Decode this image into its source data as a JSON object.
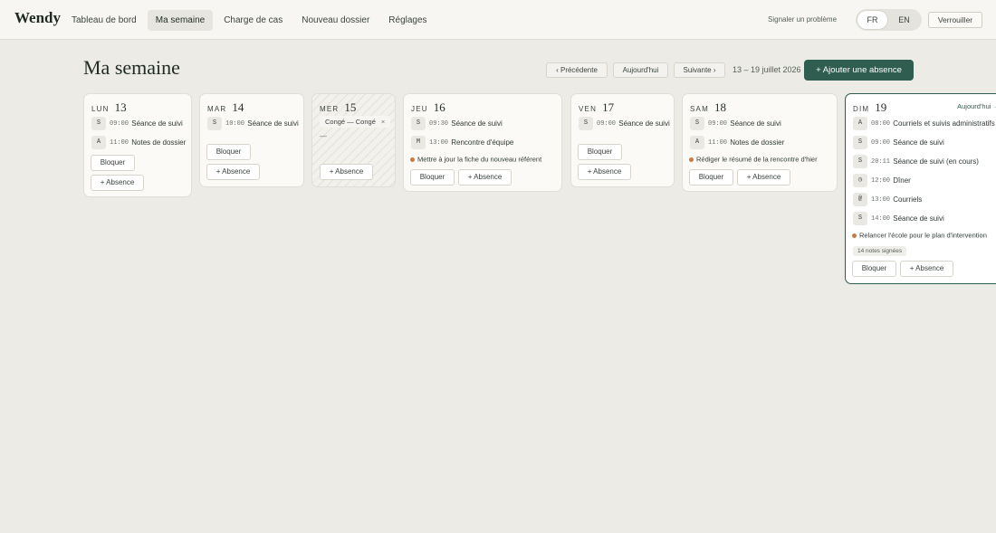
{
  "app": {
    "brand": "Wendy"
  },
  "nav": [
    {
      "label": "Tableau de bord",
      "active": false
    },
    {
      "label": "Ma semaine",
      "active": true
    },
    {
      "label": "Charge de cas",
      "active": false
    },
    {
      "label": "Nouveau dossier",
      "active": false
    },
    {
      "label": "Réglages",
      "active": false
    }
  ],
  "header_right": {
    "report": "Signaler un problème",
    "lang_fr": "FR",
    "lang_en": "EN",
    "lock": "Verrouiller"
  },
  "page": {
    "title": "Ma semaine",
    "prev": "‹ Précédente",
    "today": "Aujourd'hui",
    "next": "Suivante ›",
    "range": "13 – 19 juillet 2026",
    "add_absence": "+ Ajouter une absence"
  },
  "colors": {
    "accent": "#2f5d50",
    "todo_dot": "#c97a45",
    "background": "#ecebe6"
  },
  "icons": {
    "todo": "dot-icon",
    "dinner": "clock-icon",
    "email": "at-icon"
  },
  "days": [
    {
      "dow": "LUN",
      "num": "13",
      "events": [
        {
          "badge": "S",
          "time": "09:00",
          "title": "Séance de suivi"
        },
        {
          "badge": "A",
          "time": "11:00",
          "title": "Notes de dossier"
        }
      ],
      "block": "Bloquer",
      "absence": "+ Absence"
    },
    {
      "dow": "MAR",
      "num": "14",
      "events": [
        {
          "badge": "S",
          "time": "10:00",
          "title": "Séance de suivi"
        }
      ],
      "block": "Bloquer",
      "absence": "+ Absence"
    },
    {
      "dow": "MER",
      "num": "15",
      "leave": "Congé — Congé",
      "leave_close": "×",
      "empty": "—",
      "absence": "+ Absence"
    },
    {
      "dow": "JEU",
      "num": "16",
      "events": [
        {
          "badge": "S",
          "time": "09:30",
          "title": "Séance de suivi"
        },
        {
          "badge": "M",
          "time": "13:00",
          "title": "Rencontre d'équipe"
        }
      ],
      "todo": "Mettre à jour la fiche du nouveau référent",
      "block": "Bloquer",
      "absence": "+ Absence"
    },
    {
      "dow": "VEN",
      "num": "17",
      "events": [
        {
          "badge": "S",
          "time": "09:00",
          "title": "Séance de suivi"
        }
      ],
      "block": "Bloquer",
      "absence": "+ Absence"
    },
    {
      "dow": "SAM",
      "num": "18",
      "events": [
        {
          "badge": "S",
          "time": "09:00",
          "title": "Séance de suivi"
        },
        {
          "badge": "A",
          "time": "11:00",
          "title": "Notes de dossier"
        }
      ],
      "todo": "Rédiger le résumé de la rencontre d'hier",
      "block": "Bloquer",
      "absence": "+ Absence"
    },
    {
      "dow": "DIM",
      "num": "19",
      "today_label": "Aujourd'hui →",
      "events": [
        {
          "badge": "A",
          "time": "08:00",
          "title": "Courriels et suivis administratifs"
        },
        {
          "badge": "S",
          "time": "09:00",
          "title": "Séance de suivi"
        },
        {
          "badge": "S",
          "time": "20:11",
          "title": "Séance de suivi (en cours)"
        },
        {
          "badge": "◷",
          "time": "12:00",
          "title": "Dîner"
        },
        {
          "badge": "@",
          "time": "13:00",
          "title": "Courriels"
        },
        {
          "badge": "S",
          "time": "14:00",
          "title": "Séance de suivi"
        }
      ],
      "todo": "Relancer l'école pour le plan d'intervention",
      "notes": "14 notes signées",
      "block": "Bloquer",
      "absence": "+ Absence"
    }
  ]
}
